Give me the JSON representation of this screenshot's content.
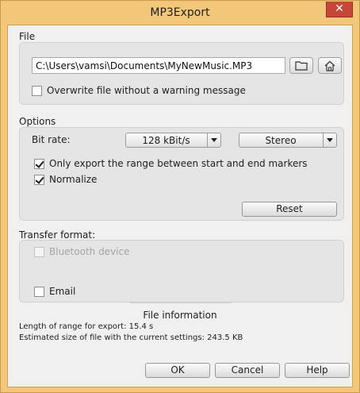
{
  "window": {
    "title": "MP3Export",
    "close_glyph": "✕"
  },
  "file": {
    "label": "File",
    "path": "C:\\Users\\vamsi\\Documents\\MyNewMusic.MP3",
    "browse_icon": "folder-icon",
    "home_icon": "home-icon",
    "overwrite": {
      "label": "Overwrite file without a warning message",
      "checked": false
    }
  },
  "options": {
    "label": "Options",
    "bitrate_label": "Bit rate:",
    "bitrate_value": "128 kBit/s",
    "channel_value": "Stereo",
    "range_only": {
      "label": "Only export the range between start and end markers",
      "checked": true
    },
    "normalize": {
      "label": "Normalize",
      "checked": true
    },
    "reset_label": "Reset"
  },
  "transfer": {
    "label": "Transfer format:",
    "bluetooth": {
      "label": "Bluetooth device",
      "checked": false,
      "enabled": false
    },
    "email": {
      "label": "Email",
      "checked": false
    }
  },
  "info": {
    "title": "File information",
    "length_line": "Length of range for export: 15.4 s",
    "size_line": "Estimated size of file with the current settings: 243.5 KB"
  },
  "footer": {
    "ok_label": "OK",
    "cancel_label": "Cancel",
    "help_label": "Help"
  },
  "colors": {
    "frame": "#f3c77a",
    "close": "#c7463a",
    "client": "#f0f0f0",
    "group": "#e5e5e5"
  }
}
